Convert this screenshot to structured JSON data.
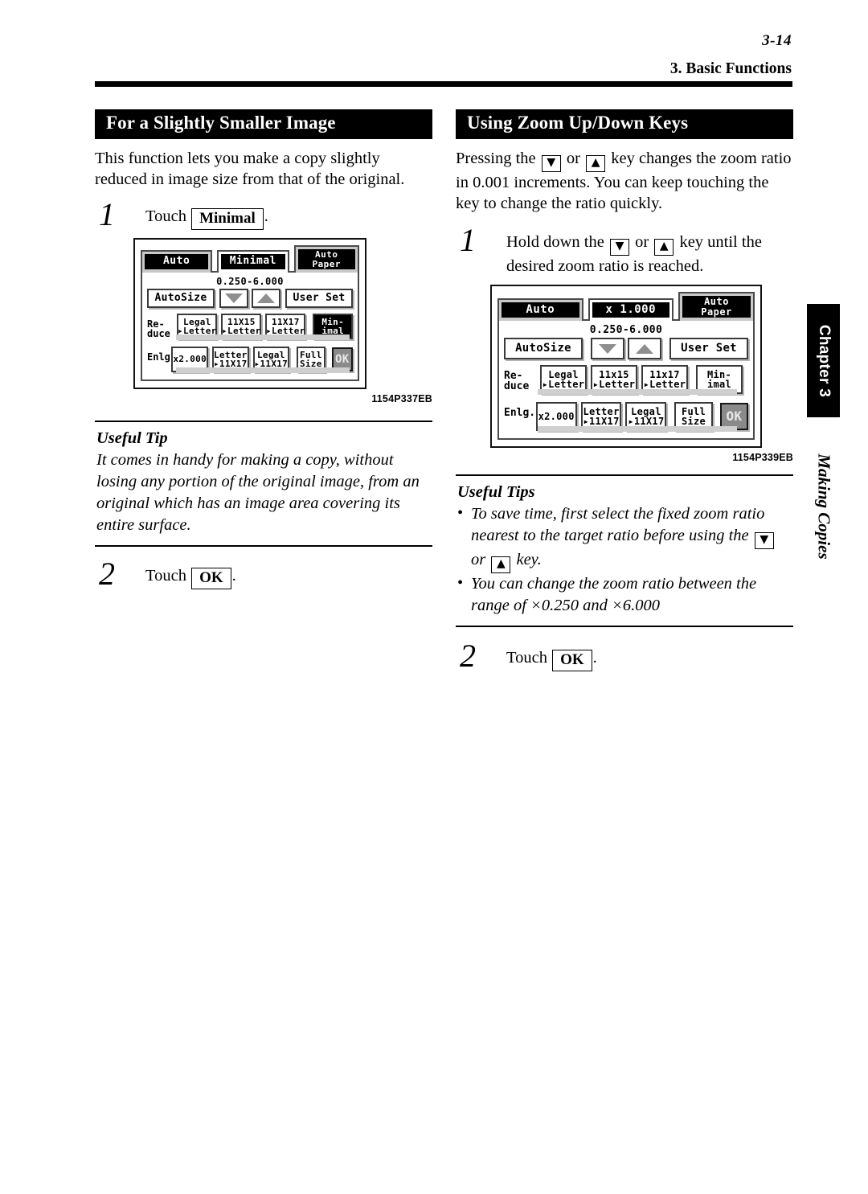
{
  "header": {
    "page_number": "3-14",
    "running_head": "3. Basic Functions"
  },
  "side_tab": {
    "chapter_label": "Chapter 3",
    "section_label": "Making Copies"
  },
  "left_column": {
    "section_title": "For a Slightly Smaller Image",
    "intro": "This function lets you make a copy slightly reduced in image size from that of the original.",
    "step1": {
      "number": "1",
      "prefix": "Touch",
      "key": "Minimal",
      "suffix": "."
    },
    "figure_caption": "1154P337EB",
    "tip": {
      "title": "Useful Tip",
      "text": "It comes in handy for making a copy, without losing any portion of the original image, from an original which has an image area covering its entire surface."
    },
    "step2": {
      "number": "2",
      "prefix": "Touch",
      "key": "OK",
      "suffix": "."
    }
  },
  "right_column": {
    "section_title": "Using Zoom Up/Down Keys",
    "intro_a": "Pressing the",
    "intro_or": "or",
    "intro_b": "key changes the zoom ratio in 0.001 increments. You can keep touching the key to change the ratio quickly.",
    "step1": {
      "number": "1",
      "text_a": "Hold down the",
      "text_or": "or",
      "text_b": "key until the desired zoom ratio is reached."
    },
    "figure_caption": "1154P339EB",
    "tips": {
      "title": "Useful Tips",
      "bullet1_a": "To save time, first select the fixed zoom ratio nearest to the target ratio before using the",
      "bullet1_or": "or",
      "bullet1_b": "key.",
      "bullet2": "You can change the zoom ratio between the range of ×0.250 and ×6.000"
    },
    "step2": {
      "number": "2",
      "prefix": "Touch",
      "key": "OK",
      "suffix": "."
    }
  },
  "glyphs": {
    "down_arrow": "▼",
    "up_arrow": "▲",
    "bullet": "•"
  },
  "lcd_left": {
    "tabs": [
      {
        "label": "Auto",
        "selected": false
      },
      {
        "label": "Minimal",
        "selected": true
      },
      {
        "label_line1": "Auto",
        "label_line2": "Paper",
        "selected": false
      }
    ],
    "ratio_range": "0.250-6.000",
    "autosize_label": "AutoSize",
    "userset_label": "User Set",
    "reduce_label": "Re-\nduce",
    "enlarge_label": "Enlg.",
    "reduce_buttons": [
      {
        "line1": "Legal",
        "line2": "▸Letter",
        "highlighted": false
      },
      {
        "line1": "11X15",
        "line2": "▸Letter",
        "highlighted": false
      },
      {
        "line1": "11X17",
        "line2": "▸Letter",
        "highlighted": false
      },
      {
        "line1": "Min-",
        "line2": "imal",
        "highlighted": true
      }
    ],
    "enlarge_buttons": [
      {
        "line1": "x2.000",
        "line2": "",
        "highlighted": false
      },
      {
        "line1": "Letter",
        "line2": "▸11X17",
        "highlighted": false
      },
      {
        "line1": "Legal",
        "line2": "▸11X17",
        "highlighted": false
      },
      {
        "line1": "Full",
        "line2": "Size",
        "highlighted": false
      }
    ],
    "ok_label": "OK"
  },
  "lcd_right": {
    "tabs": [
      {
        "label": "Auto",
        "selected": false
      },
      {
        "label": "x 1.000",
        "selected": true
      },
      {
        "label_line1": "Auto",
        "label_line2": "Paper",
        "selected": false
      }
    ],
    "ratio_range": "0.250-6.000",
    "autosize_label": "AutoSize",
    "userset_label": "User Set",
    "reduce_label": "Re-\nduce",
    "enlarge_label": "Enlg.",
    "reduce_buttons": [
      {
        "line1": "Legal",
        "line2": "▸Letter",
        "highlighted": false
      },
      {
        "line1": "11x15",
        "line2": "▸Letter",
        "highlighted": false
      },
      {
        "line1": "11x17",
        "line2": "▸Letter",
        "highlighted": false
      },
      {
        "line1": "Min-",
        "line2": "imal",
        "highlighted": false
      }
    ],
    "enlarge_buttons": [
      {
        "line1": "x2.000",
        "line2": "",
        "highlighted": false
      },
      {
        "line1": "Letter",
        "line2": "▸11X17",
        "highlighted": false
      },
      {
        "line1": "Legal",
        "line2": "▸11X17",
        "highlighted": false
      },
      {
        "line1": "Full",
        "line2": "Size",
        "highlighted": false
      }
    ],
    "ok_label": "OK"
  }
}
